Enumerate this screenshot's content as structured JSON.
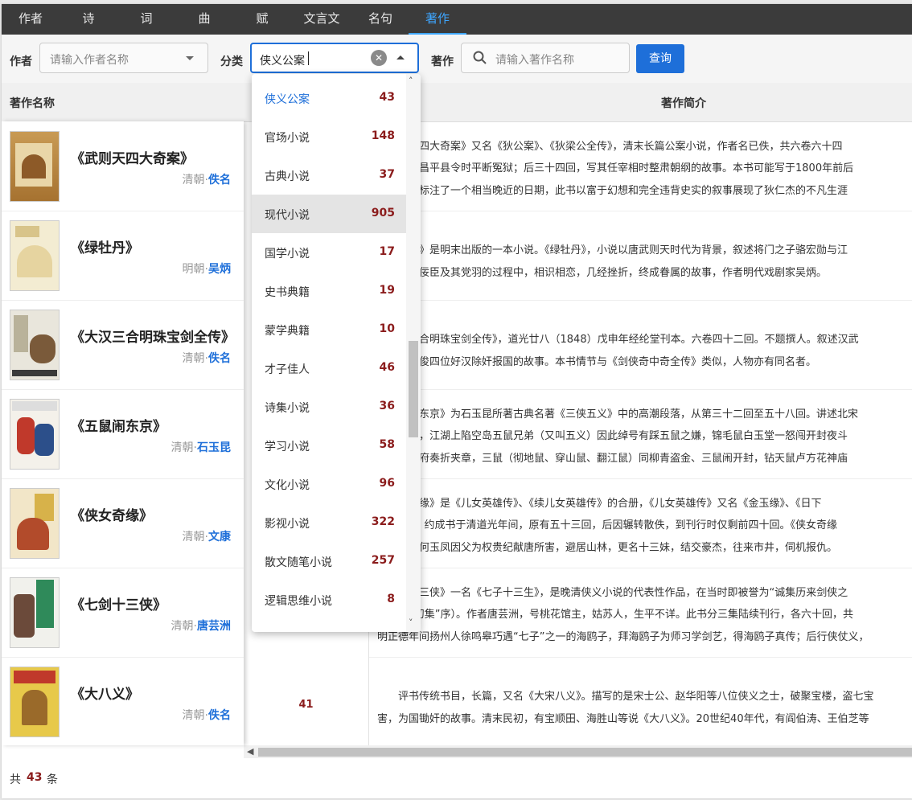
{
  "nav": {
    "tabs": [
      "作者",
      "诗",
      "词",
      "曲",
      "赋",
      "文言文",
      "名句",
      "著作"
    ]
  },
  "filters": {
    "author_label": "作者",
    "author_placeholder": "请输入作者名称",
    "category_label": "分类",
    "category_value": "侠义公案",
    "work_label": "著作",
    "work_placeholder": "请输入著作名称",
    "query_button": "查询"
  },
  "table": {
    "col_title": "著作名称",
    "col_desc": "著作简介",
    "rows": [
      {
        "title": "《武则天四大奇案》",
        "dynasty": "清朝",
        "author": "佚名",
        "count": "",
        "desc": [
          "《武则天四大奇案》又名《狄公案》、《狄梁公全传》，清末长篇公案小说，作者名已佚，共六卷六十四",
          "狄仁杰任昌平县令时平断冤狱；后三十四回，写其任宰相时整肃朝纲的故事。本书可能写于1800年前后",
          "出版本却标注了一个相当晚近的日期，此书以富于幻想和完全违背史实的叙事展现了狄仁杰的不凡生涯"
        ]
      },
      {
        "title": "《绿牡丹》",
        "dynasty": "明朝",
        "author": "吴炳",
        "count": "",
        "desc": [
          "《绿牡丹》是明末出版的一本小说。《绿牡丹》，小说以唐武则天时代为背景，叙述将门之子骆宏勋与江",
          "铲除武周佞臣及其党羽的过程中，相识相恋，几经挫折，终成眷属的故事，作者明代戏剧家吴炳。"
        ]
      },
      {
        "title": "《大汉三合明珠宝剑全传》",
        "dynasty": "清朝",
        "author": "佚名",
        "count": "",
        "desc": [
          "《大汉三合明珠宝剑全传》，道光廿八（1848）戊申年经纶堂刊本。六卷四十二回。不题撰人。叙述汉武",
          "何刚、马俊四位好汉除奸报国的故事。本书情节与《剑侠奇中奇全传》类似，人物亦有同名者。"
        ]
      },
      {
        "title": "《五鼠闹东京》",
        "dynasty": "清朝",
        "author": "石玉昆",
        "count": "",
        "desc": [
          "《五鼠闹东京》为石玉昆所著古典名著《三侠五义》中的高潮段落，从第三十二回至五十八回。讲述北宋",
          "封做御猫，江湖上陷空岛五鼠兄弟（又叫五义）因此绰号有踩五鼠之嫌，锦毛鼠白玉堂一怒闯开封夜斗",
          "书、太师府奏折夹章，三鼠（彻地鼠、穿山鼠、翻江鼠）同柳青盗金、三鼠闹开封，钻天鼠卢方花神庙"
        ]
      },
      {
        "title": "《侠女奇缘》",
        "dynasty": "清朝",
        "author": "文康",
        "count": "",
        "desc": [
          "《侠女奇缘》是《儿女英雄传》、《续儿女英雄传》的合册，《儿女英雄传》又名《金玉缘》、《日下",
          "十三参》。约成书于清道光年间，原有五十三回，后因辗转散佚，到刊行时仅剩前四十回。《侠女奇缘",
          "名门侠女何玉凤因父为权贵纪献唐所害，避居山林，更名十三妹，结交豪杰，往来市井，伺机报仇。"
        ]
      },
      {
        "title": "《七剑十三侠》",
        "dynasty": "清朝",
        "author": "唐芸洲",
        "count": "",
        "desc": [
          "《七剑十三侠》一名《七子十三生》，是晚清侠义小说的代表性作品，在当时即被誉为“诚集历来剑侠之",
          "（文蒲“初集”序）。作者唐芸洲，号桃花馆主，姑苏人，生平不详。此书分三集陆续刊行，各六十回，共",
          "明正德年间扬州人徐鸣皋巧遇“七子”之一的海鸥子，拜海鸥子为师习学剑艺，得海鸥子真传；后行侠仗义，"
        ]
      },
      {
        "title": "《大八义》",
        "dynasty": "清朝",
        "author": "佚名",
        "count": "41",
        "desc": [
          "　　评书传统书目，长篇，又名《大宋八义》。描写的是宋士公、赵华阳等八位侠义之士，破聚宝楼，盗七宝",
          "害，为国锄奸的故事。清末民初，有宝顺田、海胜山等说《大八义》。20世纪40年代，有阎伯涛、王伯芝等"
        ]
      }
    ],
    "dot": "·"
  },
  "footer": {
    "prefix": "共",
    "total": "43",
    "suffix": "条"
  },
  "dropdown": {
    "options": [
      {
        "label": "侠义公案",
        "count": "43"
      },
      {
        "label": "官场小说",
        "count": "148"
      },
      {
        "label": "古典小说",
        "count": "37"
      },
      {
        "label": "现代小说",
        "count": "905"
      },
      {
        "label": "国学小说",
        "count": "17"
      },
      {
        "label": "史书典籍",
        "count": "19"
      },
      {
        "label": "蒙学典籍",
        "count": "10"
      },
      {
        "label": "才子佳人",
        "count": "46"
      },
      {
        "label": "诗集小说",
        "count": "36"
      },
      {
        "label": "学习小说",
        "count": "58"
      },
      {
        "label": "文化小说",
        "count": "96"
      },
      {
        "label": "影视小说",
        "count": "322"
      },
      {
        "label": "散文随笔小说",
        "count": "257"
      },
      {
        "label": "逻辑思维小说",
        "count": "8"
      }
    ]
  },
  "colors": {
    "accent": "#1e6fd9",
    "count_red": "#8b1c1c",
    "nav_bg": "#3b3b3b"
  }
}
